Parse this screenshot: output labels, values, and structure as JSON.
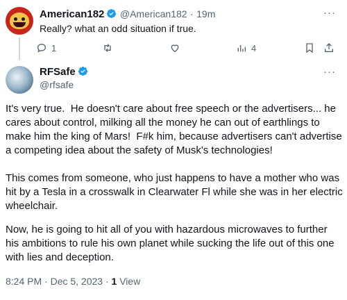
{
  "reply_tweet": {
    "display_name": "American182",
    "handle": "@American182",
    "separator": "·",
    "time": "19m",
    "text": "Really? what an odd situation if true.",
    "actions": {
      "reply_count": "1",
      "retweet_count": "",
      "like_count": "",
      "views_count": "4"
    }
  },
  "main_tweet": {
    "display_name": "RFSafe",
    "handle": "@rfsafe",
    "paragraphs": [
      "It's very true.  He doesn't care about free speech or the advertisers... he cares about control, milking all the money he can out of earthlings to make him the king of Mars!  F#k him, because advertisers can't advertise a competing idea about the safety of Musk's technologies!",
      "This comes from someone, who just happens to have a mother who was hit by a Tesla in a crosswalk in Clearwater Fl while she was in her electric wheelchair.",
      "Now, he is going to hit all of you with hazardous microwaves to further his ambitions to rule his own planet while sucking the life out of this one with lies and deception."
    ],
    "timestamp": "8:24 PM · Dec 5, 2023 · ",
    "views_count": "1",
    "views_label": "View"
  },
  "colors": {
    "verified_blue": "#1d9bf0",
    "muted": "#536471",
    "text": "#0f1419"
  },
  "icons": {
    "verified": "verified-badge-icon",
    "more": "more-horizontal-icon",
    "reply": "reply-icon",
    "retweet": "retweet-icon",
    "like": "heart-icon",
    "views": "views-chart-icon",
    "bookmark": "bookmark-icon",
    "share": "share-icon"
  }
}
